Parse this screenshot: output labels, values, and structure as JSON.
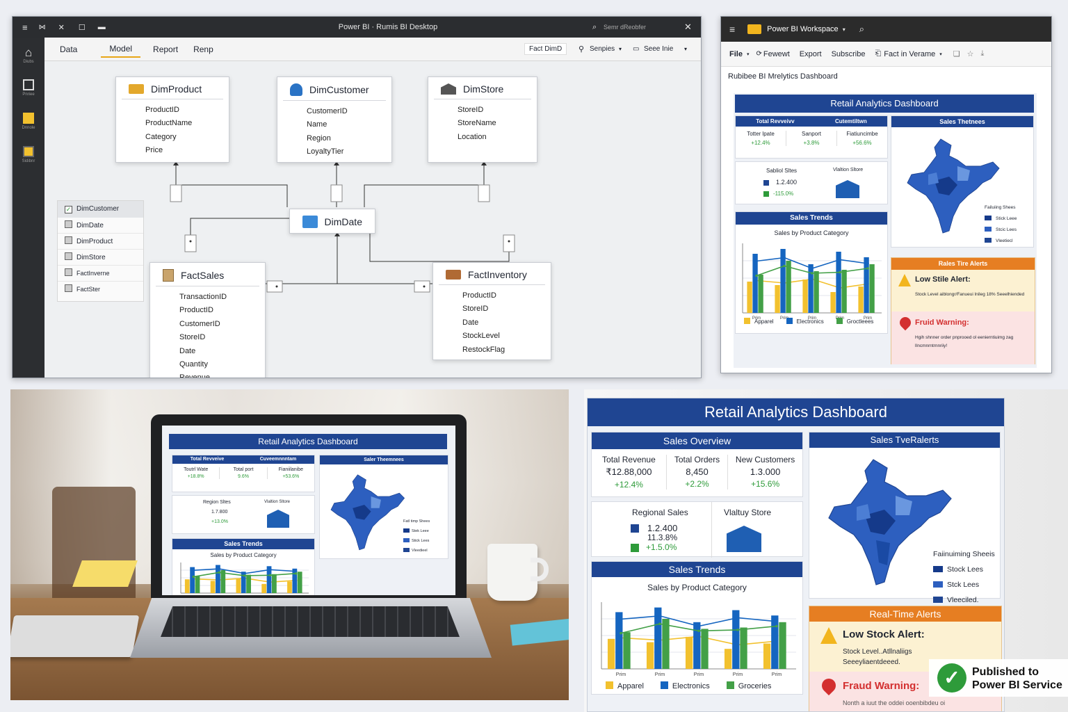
{
  "desktop": {
    "title": "Power BI  ·  Rumis BI Desktop",
    "search_placeholder": "Semr dReobfer",
    "ribbon_tabs": [
      "Data",
      "Model",
      "Report",
      "Renp"
    ],
    "ribbon_right": [
      "Fact DimD",
      "Senpies",
      "Seee Inie"
    ],
    "nav_items": [
      "Diubs",
      "Pnriee",
      "Dnnole",
      "Sidibnr"
    ],
    "tables": [
      {
        "name": "DimProduct",
        "fields": [
          "ProductID",
          "ProductName",
          "Category",
          "Price"
        ]
      },
      {
        "name": "DimCustomer",
        "fields": [
          "CustomerID",
          "Name",
          "Region",
          "LoyaltyTier"
        ]
      },
      {
        "name": "DimStore",
        "fields": [
          "StoreID",
          "StoreName",
          "Location"
        ]
      },
      {
        "name": "DimDate",
        "fields": []
      },
      {
        "name": "FactSales",
        "fields": [
          "TransactionID",
          "ProductID",
          "CustomerID",
          "StoreID",
          "Date",
          "Quantity",
          "Revenue"
        ]
      },
      {
        "name": "FactInventory",
        "fields": [
          "ProductID",
          "StoreID",
          "Date",
          "StockLevel",
          "RestockFlag"
        ]
      }
    ],
    "field_list": [
      "DimCustomer",
      "DimDate",
      "DimProduct",
      "DimStore",
      "FactInverne",
      "FactSter"
    ]
  },
  "service": {
    "title": "Power BI Workspace",
    "toolbar": [
      "File",
      "Fewewt",
      "Export",
      "Subscribe",
      "Fact in Verame"
    ],
    "report_name": "Rubibee BI Mrelytics Dashboard",
    "dash_title": "Retail Analytics Dashboard",
    "overview_hdr": "Total Revveivv",
    "overview_hdr2": "Cutemtiltwn",
    "kpis": [
      {
        "label": "Totter lpate",
        "value": "+12.4%"
      },
      {
        "label": "Sanport",
        "value": "+3.8%"
      },
      {
        "label": "Fiatiuncimbe",
        "value": "+56.6%"
      }
    ],
    "regional_label": "Sabliol Sltes",
    "regional_value": "1.2.400",
    "regional_delta": "-115.0%",
    "store_label": "Vlaltion Sltore",
    "trends_hdr": "Sales Trends",
    "trends_sub": "Sales by Product Category",
    "map_hdr": "Sales Thetnees",
    "map_legend": [
      "Failuiing Shees",
      "Stick Leee",
      "Stcic Lees",
      "Vleetiecl"
    ],
    "alerts_hdr": "Rales Tire Alerts",
    "alert1_title": "Low Stile Alert:",
    "alert1_body": "Stock Level aiblongr/Fanueui lnileg 18%  Seeelhiended",
    "alert2_title": "Fruid Warning:",
    "alert2_body": "Hgih shnner order pnprooed ol  eenierntiuimg zag lIncmnrntrnnriiy!",
    "ticks": [
      "Prim",
      "Prim",
      "Prim",
      "Prim",
      "Prim"
    ],
    "legend": [
      "Apparel",
      "Electronics",
      "Groctleees"
    ]
  },
  "laptop": {
    "dash_title": "Retail Analytics Dashboard",
    "overview_hdr": "Total Revveive",
    "overview_hdr2": "Cuveemnnntam",
    "kpis": [
      {
        "label": "Toutrl Wate",
        "value": "+18.8%"
      },
      {
        "label": "Total port",
        "value": "9.6%"
      },
      {
        "label": "Fianiilanibe",
        "value": "+53.6%"
      }
    ],
    "regional_label": "Region Sltes",
    "regional_value": "1.7.800",
    "regional_delta": "+13.0%",
    "store_label": "Vlaltion Sltore",
    "map_hdr": "Saler Theemnees",
    "trends_hdr": "Sales Trends",
    "trends_sub": "Sales by Product Category",
    "map_legend": [
      "Fatl timp Shees",
      "Stek Leee",
      "Stick Lees",
      "Vleedieel"
    ]
  },
  "published": {
    "dash_title": "Retail Analytics Dashboard",
    "overview_hdr": "Sales Overview",
    "kpis": [
      {
        "label": "Total Revenue",
        "value": "₹12.88,000",
        "delta": "+12.4%"
      },
      {
        "label": "Total Orders",
        "value": "8,450",
        "delta": "+2.2%"
      },
      {
        "label": "New Customers",
        "value": "1.3.000",
        "delta": "+15.6%"
      }
    ],
    "regional_label": "Regional Sales",
    "regional_value": "1.2.400",
    "regional_v2": "11.3.8%",
    "regional_delta": "+1.5.0%",
    "store_label": "Vlaltuy Store",
    "map_hdr": "Sales TveRalerts",
    "map_legend": [
      "Faiinuiming Sheeis",
      "Stock Lees",
      "Stck Lees",
      "Vleeciled."
    ],
    "trends_hdr": "Sales Trends",
    "trends_sub": "Sales by Product Category",
    "ticks": [
      "Prim",
      "Prim",
      "Prim",
      "Prim",
      "Prim"
    ],
    "legend": [
      "Apparel",
      "Electronics",
      "Groceries"
    ],
    "alerts_hdr": "Real-Time Alerts",
    "alert1_title": "Low Stock Alert:",
    "alert1_body": "Stock Level..Atllnaliigs  Seeeyliaentdeeed.",
    "alert2_title": "Fraud Warning:",
    "alert2_body": "Nonth a iuut the oddei ooenbibdeu oi",
    "badge": "Published to Power BI Service"
  },
  "chart_data": {
    "type": "bar",
    "categories": [
      "Prim",
      "Prim",
      "Prim",
      "Prim",
      "Prim"
    ],
    "series": [
      {
        "name": "Apparel",
        "values": [
          45,
          40,
          48,
          30,
          38
        ]
      },
      {
        "name": "Electronics",
        "values": [
          85,
          92,
          70,
          88,
          80
        ]
      },
      {
        "name": "Groceries",
        "values": [
          55,
          75,
          60,
          62,
          70
        ]
      }
    ],
    "colors": {
      "Apparel": "#f2c12e",
      "Electronics": "#1565c0",
      "Groceries": "#43a047"
    }
  }
}
